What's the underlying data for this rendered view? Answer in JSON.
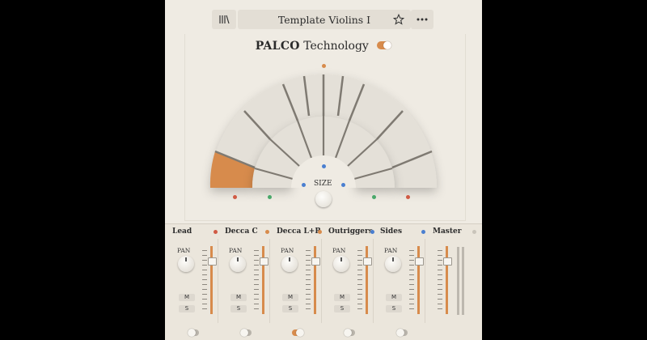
{
  "header": {
    "library_icon": "library-books-icon",
    "preset_name": "Template Violins I",
    "star_icon": "star-outline-icon",
    "more_icon": "more-horizontal-icon"
  },
  "palco": {
    "title_bold": "PALCO",
    "title_rest": " Technology",
    "enabled": true
  },
  "stage": {
    "size_label": "SIZE",
    "selected_segment": "outer-left-1",
    "mic_dot_colors": [
      "#d05a44",
      "#4aa86a",
      "#4a7fd0",
      "#d78b4c"
    ]
  },
  "mixer": {
    "channels": [
      {
        "name": "Lead",
        "dot": "#d05a44",
        "pan_label": "PAN",
        "mute": "M",
        "solo": "S",
        "toggle_on": false
      },
      {
        "name": "Decca C",
        "dot": "#d78b4c",
        "pan_label": "PAN",
        "mute": "M",
        "solo": "S",
        "toggle_on": false
      },
      {
        "name": "Decca L+R",
        "dot": "#d78b4c",
        "pan_label": "PAN",
        "mute": "M",
        "solo": "S",
        "toggle_on": true
      },
      {
        "name": "Outriggers",
        "dot": "#4a7fd0",
        "pan_label": "PAN",
        "mute": "M",
        "solo": "S",
        "toggle_on": false
      },
      {
        "name": "Sides",
        "dot": "#4a7fd0",
        "pan_label": "PAN",
        "mute": "M",
        "solo": "S",
        "toggle_on": false
      },
      {
        "name": "Master",
        "dot": "#c9c4ba"
      }
    ]
  },
  "colors": {
    "accent": "#d78b4c",
    "panel": "#efebe3"
  }
}
